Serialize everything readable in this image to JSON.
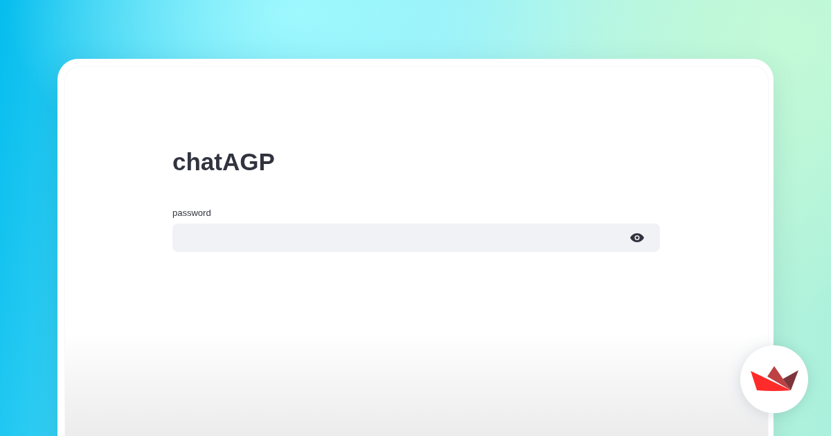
{
  "app": {
    "title": "chatAGP"
  },
  "password_field": {
    "label": "password"
  }
}
